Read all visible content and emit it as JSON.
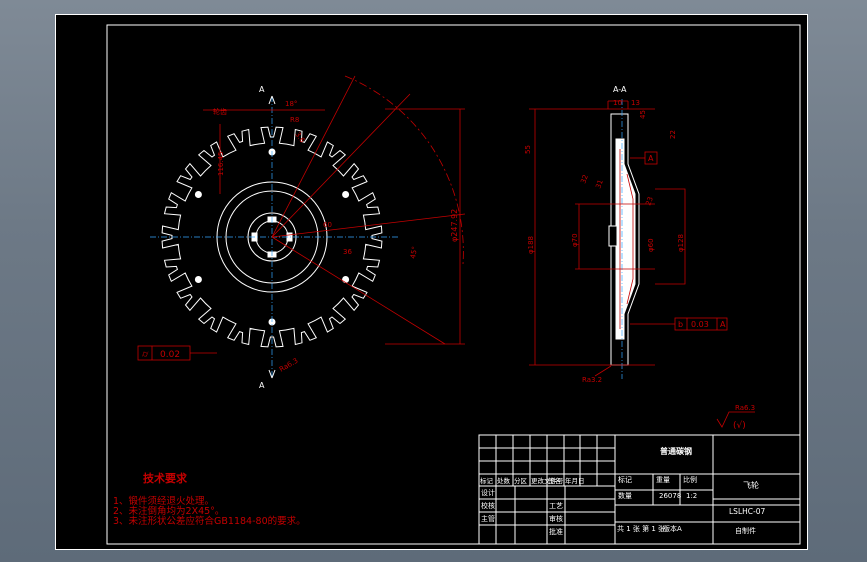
{
  "front_view": {
    "section_marker": "A",
    "tooth_count": 20,
    "labels": {
      "tooth_angle": "18°",
      "radius_r": "R8",
      "dim_a": "116.45",
      "dim_b": "3.6",
      "outer_dia": "φ247.92",
      "tooth_pitch": "45°",
      "pitch_dim": "60",
      "hub_dim": "36",
      "roughness_left": "Ra6.3",
      "label_top_left": "轮齿",
      "tolerance_symbol": "⌭",
      "tolerance_value": "0.02"
    }
  },
  "section_view": {
    "title": "A-A",
    "labels": {
      "d_top": "10",
      "d_top2": "13",
      "d_right1": "45",
      "d_right2": "22",
      "d_left": "55",
      "d_mid1": "32",
      "d_mid2": "31",
      "d_mid3": "23",
      "dia_outer": "φ188",
      "dia_hub": "φ70",
      "dia_bore": "φ60",
      "dia_128": "φ128",
      "datum": "A",
      "runout_symbol": "↗",
      "runout_value": "0.03",
      "runout_datum": "A",
      "roughness_bottom": "Ra3.2",
      "runout_box2": "b"
    }
  },
  "general_roughness": {
    "value": "Ra6.3",
    "paren": "(√)"
  },
  "tech_requirements": {
    "title": "技术要求",
    "items": [
      "1、锻件须经退火处理。",
      "2、未注倒角均为2X45°。",
      "3、未注形状公差应符合GB1184-80的要求。"
    ]
  },
  "title_block": {
    "material": "普通碳钢",
    "part_name": "飞轮",
    "drawing_no": "LSLHC-07",
    "scale_header": "比例",
    "weight_header": "重量",
    "mark_header": "标记",
    "stage_header": "阶段标记",
    "qty_label": "数量",
    "weight_value": "26078",
    "scale_value": "1:2",
    "sheet_info": "共 1 张 第 1 张",
    "version": "版本A",
    "source": "自制件",
    "row_headers": [
      "标记",
      "处数",
      "分区",
      "更改文件号",
      "签名",
      "年月日"
    ],
    "roles": [
      "设计",
      "校核",
      "主管"
    ],
    "roles2": [
      "工艺",
      "审核",
      "批准"
    ]
  }
}
